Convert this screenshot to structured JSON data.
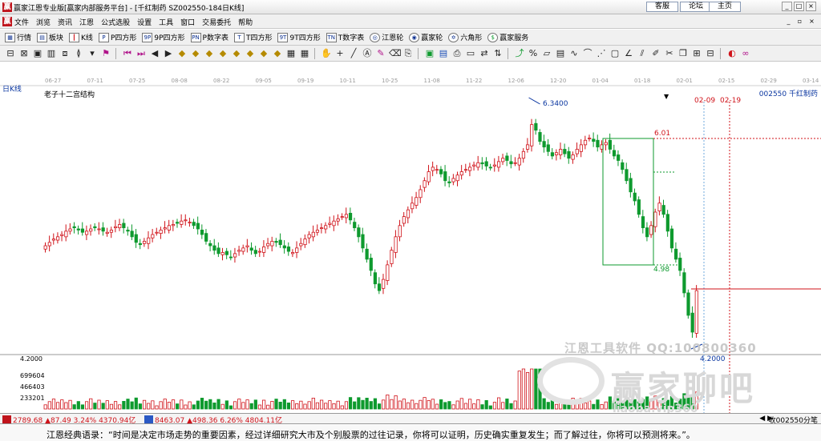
{
  "window": {
    "title": "赢家江恩专业版[赢家内部服务平台] - [千红制药  SZ002550-184日K线]",
    "links": [
      "客服",
      "论坛",
      "主页"
    ]
  },
  "menu": {
    "items": [
      "文件",
      "浏览",
      "资讯",
      "江恩",
      "公式选股",
      "设置",
      "工具",
      "窗口",
      "交易委托",
      "帮助"
    ]
  },
  "toolbar1": {
    "items": [
      {
        "label": "行情",
        "icon": "grid-icon"
      },
      {
        "label": "板块",
        "icon": "blocks-icon"
      },
      {
        "label": "K线",
        "icon": "candle-icon"
      },
      {
        "label": "P四方形",
        "icon": "square-icon"
      },
      {
        "label": "9P四方形",
        "icon": "square9-icon"
      },
      {
        "label": "P数字表",
        "icon": "table-icon"
      },
      {
        "label": "T四方形",
        "icon": "tsquare-icon"
      },
      {
        "label": "9T四方形",
        "icon": "tsquare9-icon"
      },
      {
        "label": "T数字表",
        "icon": "ttable-icon"
      },
      {
        "label": "江恩轮",
        "icon": "wheel-icon"
      },
      {
        "label": "赢家轮",
        "icon": "wheel2-icon"
      },
      {
        "label": "六角形",
        "icon": "hexagon-icon"
      },
      {
        "label": "赢家服务",
        "icon": "dollar-icon"
      }
    ]
  },
  "chart": {
    "period_label": "日K线",
    "study_label": "老子十二宫结构",
    "stock_label": "002550  千红制药",
    "date_ticks": [
      "06-27",
      "07-11",
      "07-25",
      "08-08",
      "08-22",
      "09-05",
      "09-19",
      "10-11",
      "10-25",
      "11-08",
      "11-22",
      "12-06",
      "12-20",
      "01-04",
      "01-18",
      "02-01",
      "02-15",
      "02-29",
      "03-14"
    ],
    "date_markers": [
      "02-09",
      "02-19"
    ],
    "price_high": "6.3400",
    "price_low": "4.2000",
    "box_top": "6.01",
    "box_bottom": "4.98",
    "volume_axis": [
      "4.2000",
      "699604",
      "466403",
      "233201"
    ]
  },
  "watermark": {
    "line1": "江恩工具软件  QQ:100800360",
    "brand": "赢家聊吧",
    "url": "liaoba.vip360"
  },
  "status": {
    "index1": "2789.68 ▲87.49 3.24% 4370.94亿",
    "index2": "8463.07 ▲498.36 6.26% 4804.11亿",
    "right": "收002550分笔"
  },
  "quote": {
    "text": "江恩经典语录：“时间是决定市场走势的重要因素，经过详细研究大市及个别股票的过往记录，你将可以证明，历史确实重复发生；而了解过往，你将可以预测将来。”。"
  },
  "colors": {
    "up": "#d0131a",
    "down": "#0e9a2e",
    "accent": "#0a36a0"
  },
  "chart_data": {
    "type": "candlestick",
    "price_high": 6.34,
    "price_low": 4.2,
    "closes": [
      5.02,
      5.05,
      5.08,
      5.1,
      5.12,
      5.15,
      5.17,
      5.18,
      5.16,
      5.14,
      5.15,
      5.17,
      5.18,
      5.17,
      5.15,
      5.14,
      5.16,
      5.19,
      5.21,
      5.18,
      5.15,
      5.1,
      5.05,
      5.03,
      5.06,
      5.09,
      5.12,
      5.14,
      5.16,
      5.18,
      5.2,
      5.21,
      5.22,
      5.24,
      5.25,
      5.23,
      5.2,
      5.17,
      5.12,
      5.06,
      5.02,
      4.98,
      4.95,
      4.96,
      4.94,
      4.92,
      4.95,
      4.98,
      5.0,
      5.02,
      4.98,
      4.95,
      4.97,
      5.01,
      5.04,
      5.06,
      5.05,
      5.03,
      5.0,
      4.97,
      4.96,
      5.0,
      5.04,
      5.08,
      5.12,
      5.14,
      5.16,
      5.18,
      5.2,
      5.22,
      5.24,
      5.26,
      5.28,
      5.3,
      5.25,
      5.18,
      5.1,
      5.0,
      4.9,
      4.8,
      4.68,
      4.62,
      4.72,
      4.85,
      4.98,
      5.1,
      5.2,
      5.28,
      5.34,
      5.4,
      5.45,
      5.52,
      5.6,
      5.68,
      5.72,
      5.7,
      5.66,
      5.6,
      5.58,
      5.62,
      5.65,
      5.68,
      5.7,
      5.72,
      5.74,
      5.76,
      5.75,
      5.73,
      5.72,
      5.74,
      5.77,
      5.8,
      5.78,
      5.75,
      5.76,
      5.8,
      5.86,
      5.92,
      6.1,
      6.05,
      5.95,
      5.9,
      5.86,
      5.82,
      5.85,
      5.88,
      5.84,
      5.8,
      5.83,
      5.88,
      5.92,
      5.96,
      5.98,
      5.95,
      5.9,
      5.92,
      5.94,
      5.88,
      5.82,
      5.78,
      5.7,
      5.6,
      5.5,
      5.42,
      5.3,
      5.18,
      5.1,
      5.2,
      5.32,
      5.4,
      5.3,
      5.15,
      5.0,
      4.9,
      4.8,
      4.6,
      4.4,
      4.25,
      4.62
    ]
  }
}
